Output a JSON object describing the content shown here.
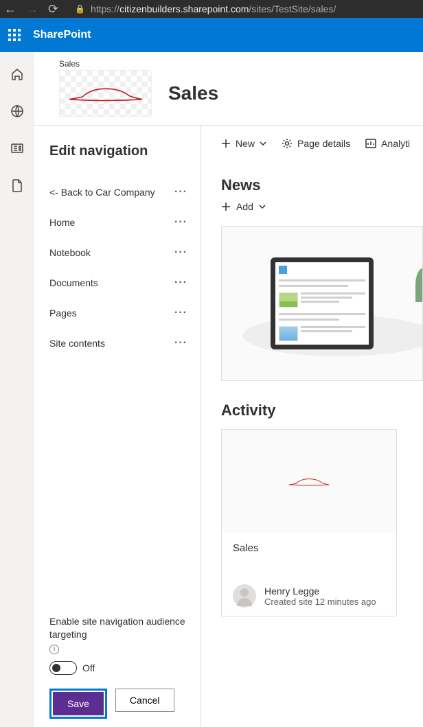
{
  "browser": {
    "url_prefix": "https://",
    "url_domain": "citizenbuilders.sharepoint.com",
    "url_path": "/sites/TestSite/sales/"
  },
  "suite": {
    "app_name": "SharePoint"
  },
  "site": {
    "breadcrumb": "Sales",
    "title": "Sales"
  },
  "nav_panel": {
    "title": "Edit navigation",
    "items": [
      {
        "label": "<- Back to Car Company"
      },
      {
        "label": "Home"
      },
      {
        "label": "Notebook"
      },
      {
        "label": "Documents"
      },
      {
        "label": "Pages"
      },
      {
        "label": "Site contents"
      }
    ],
    "targeting_label": "Enable site navigation audience targeting",
    "toggle_state": "Off",
    "save_label": "Save",
    "cancel_label": "Cancel"
  },
  "commands": {
    "new": "New",
    "page_details": "Page details",
    "analytics": "Analyti"
  },
  "news": {
    "title": "News",
    "add": "Add"
  },
  "activity": {
    "title": "Activity",
    "card": {
      "title": "Sales",
      "author": "Henry Legge",
      "meta": "Created site 12 minutes ago"
    }
  }
}
